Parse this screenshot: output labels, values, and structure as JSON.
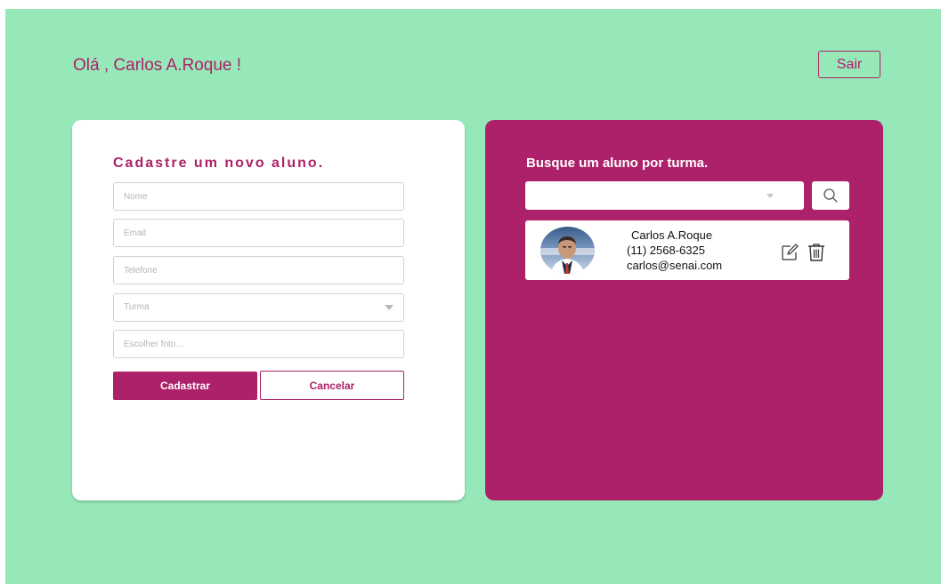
{
  "header": {
    "greeting": "Olá , Carlos A.Roque !",
    "logout_label": "Sair"
  },
  "register_form": {
    "title": "Cadastre um novo aluno.",
    "fields": {
      "name_placeholder": "Nome",
      "email_placeholder": "Email",
      "phone_placeholder": "Telefone",
      "class_placeholder": "Turma",
      "photo_placeholder": "Escolher foto..."
    },
    "submit_label": "Cadastrar",
    "cancel_label": "Cancelar"
  },
  "search_panel": {
    "title": "Busque um aluno por turma.",
    "class_select_value": "",
    "search_icon": "search-icon",
    "results": [
      {
        "name": "Carlos A.Roque",
        "phone": "(11) 2568-6325",
        "email": "carlos@senai.com",
        "edit_icon": "edit-icon",
        "delete_icon": "trash-icon"
      }
    ]
  },
  "colors": {
    "background": "#97e8b8",
    "accent": "#ac2169",
    "card": "#ffffff"
  }
}
